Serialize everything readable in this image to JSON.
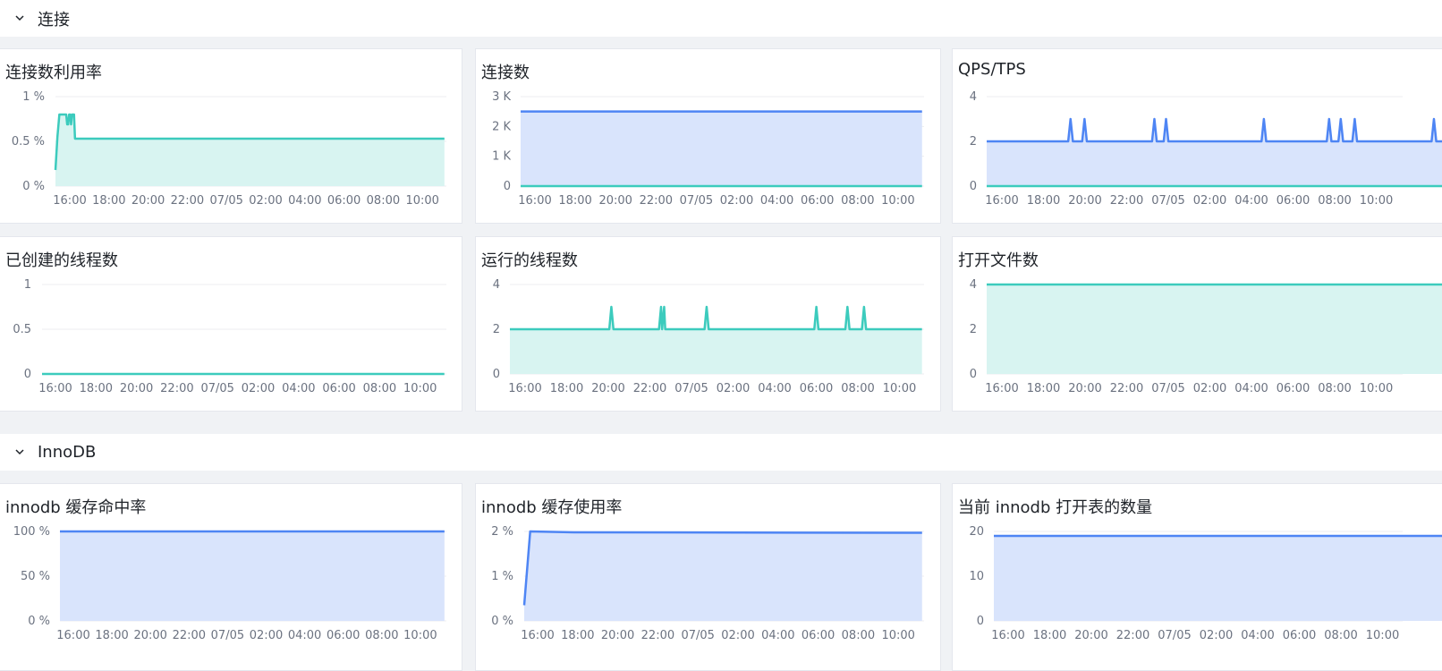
{
  "sections": [
    {
      "title": "连接"
    },
    {
      "title": "InnoDB"
    }
  ],
  "colors": {
    "teal": "#3ccbbd",
    "teal_fill": "#d8f4f1",
    "blue": "#4e85f4",
    "blue_fill": "#d9e4fc",
    "grid": "#eceef1"
  },
  "x_ticks": [
    "16:00",
    "18:00",
    "20:00",
    "22:00",
    "07/05",
    "02:00",
    "04:00",
    "06:00",
    "08:00",
    "10:00"
  ],
  "panels": [
    {
      "title": "连接数利用率"
    },
    {
      "title": "连接数"
    },
    {
      "title": "QPS/TPS"
    },
    {
      "title": "已创建的线程数"
    },
    {
      "title": "运行的线程数"
    },
    {
      "title": "打开文件数"
    },
    {
      "title": "innodb 缓存命中率"
    },
    {
      "title": "innodb 缓存使用率"
    },
    {
      "title": "当前 innodb 打开表的数量"
    }
  ],
  "chart_data": [
    {
      "type": "area",
      "ylabels": [
        "1 %",
        "0.5 %",
        "0 %"
      ],
      "ylim": [
        0,
        1
      ],
      "series": [
        {
          "color": "teal",
          "x": [
            0,
            0.1,
            0.2,
            0.3,
            0.45,
            0.5,
            0.55,
            0.6,
            0.65,
            0.7,
            0.75,
            0.8,
            0.85,
            0.9,
            0.95,
            1,
            1.3,
            2,
            4,
            6,
            8,
            10,
            12,
            14,
            16,
            18,
            19.9
          ],
          "values": [
            0.18,
            0.55,
            0.8,
            0.8,
            0.8,
            0.8,
            0.8,
            0.69,
            0.69,
            0.8,
            0.8,
            0.69,
            0.8,
            0.8,
            0.8,
            0.53,
            0.53,
            0.53,
            0.53,
            0.53,
            0.53,
            0.53,
            0.53,
            0.53,
            0.53,
            0.53,
            0.53
          ]
        }
      ]
    },
    {
      "type": "area",
      "ylabels": [
        "3 K",
        "2 K",
        "1 K",
        "0"
      ],
      "ylim": [
        0,
        3000
      ],
      "series": [
        {
          "color": "blue",
          "x": [
            0,
            19.9
          ],
          "values": [
            2500,
            2500
          ]
        },
        {
          "color": "teal",
          "x": [
            0,
            19.9
          ],
          "values": [
            0,
            0
          ]
        }
      ]
    },
    {
      "type": "area",
      "ylabels": [
        "4",
        "2",
        "0"
      ],
      "ylim": [
        0,
        4
      ],
      "series": [
        {
          "color": "blue",
          "x": [
            0,
            3.5,
            3.6,
            3.7,
            4.1,
            4.2,
            4.3,
            7.1,
            7.2,
            7.3,
            7.6,
            7.7,
            7.8,
            11.8,
            11.9,
            12,
            14.6,
            14.7,
            14.8,
            15.1,
            15.2,
            15.3,
            15.7,
            15.8,
            15.9,
            19.1,
            19.2,
            19.3,
            20
          ],
          "values": [
            2,
            2,
            3,
            2,
            2,
            3,
            2,
            2,
            3,
            2,
            2,
            3,
            2,
            2,
            3,
            2,
            2,
            3,
            2,
            2,
            3,
            2,
            2,
            3,
            2,
            2,
            3,
            2,
            2
          ]
        },
        {
          "color": "teal",
          "x": [
            0,
            20
          ],
          "values": [
            0,
            0
          ]
        }
      ]
    },
    {
      "type": "line",
      "ylabels": [
        "1",
        "0.5",
        "0"
      ],
      "ylim": [
        0,
        1
      ],
      "series": [
        {
          "color": "teal",
          "x": [
            0,
            19.9
          ],
          "values": [
            0,
            0
          ]
        }
      ]
    },
    {
      "type": "area",
      "ylabels": [
        "4",
        "2",
        "0"
      ],
      "ylim": [
        0,
        4
      ],
      "series": [
        {
          "color": "teal",
          "x": [
            0,
            4.8,
            4.9,
            5,
            7.2,
            7.3,
            7.35,
            7.45,
            7.5,
            7.6,
            9.4,
            9.5,
            9.6,
            14.7,
            14.8,
            14.9,
            16.2,
            16.3,
            16.4,
            17,
            17.1,
            17.2,
            19.9
          ],
          "values": [
            2,
            2,
            3,
            2,
            2,
            3,
            2,
            3,
            2,
            2,
            2,
            3,
            2,
            2,
            3,
            2,
            2,
            3,
            2,
            2,
            3,
            2,
            2
          ]
        }
      ]
    },
    {
      "type": "area",
      "ylabels": [
        "4",
        "2",
        "0"
      ],
      "ylim": [
        0,
        4
      ],
      "series": [
        {
          "color": "teal",
          "x": [
            0,
            20
          ],
          "values": [
            4,
            4
          ]
        }
      ]
    },
    {
      "type": "area",
      "ylabels": [
        "100 %",
        "50 %",
        "0 %"
      ],
      "ylim": [
        0,
        100
      ],
      "series": [
        {
          "color": "blue",
          "x": [
            0,
            19.9
          ],
          "values": [
            100,
            100
          ]
        }
      ]
    },
    {
      "type": "area",
      "ylabels": [
        "2 %",
        "1 %",
        "0 %"
      ],
      "ylim": [
        0,
        2
      ],
      "series": [
        {
          "color": "blue",
          "x": [
            0,
            0.3,
            2.5,
            19.9
          ],
          "values": [
            0.35,
            2,
            1.98,
            1.97
          ]
        }
      ]
    },
    {
      "type": "area",
      "ylabels": [
        "20",
        "10",
        "0"
      ],
      "ylim": [
        0,
        20
      ],
      "series": [
        {
          "color": "blue",
          "x": [
            0,
            20
          ],
          "values": [
            19,
            19
          ]
        }
      ]
    }
  ]
}
